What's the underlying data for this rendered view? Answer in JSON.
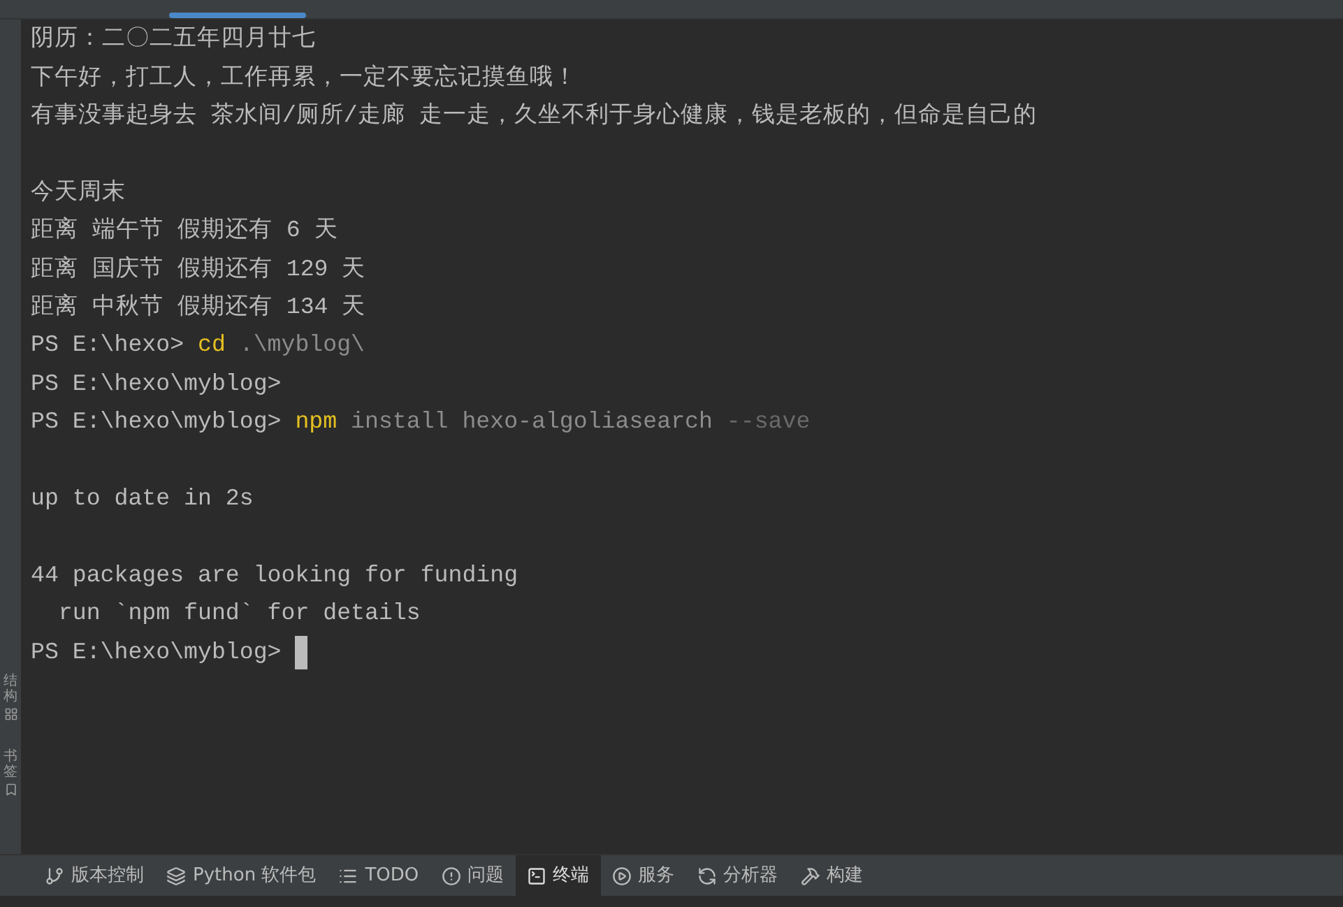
{
  "tabs": [
    {
      "selected": false
    },
    {
      "selected": true
    },
    {
      "selected": false
    }
  ],
  "sidebar": {
    "items": [
      {
        "label": "结构"
      },
      {
        "label": "书签"
      }
    ]
  },
  "terminal": {
    "lines": [
      {
        "segments": [
          {
            "text": "阴历：二〇二五年四月廿七",
            "kind": "text"
          }
        ]
      },
      {
        "segments": [
          {
            "text": "下午好，打工人，工作再累，一定不要忘记摸鱼哦！",
            "kind": "text"
          }
        ]
      },
      {
        "segments": [
          {
            "text": "有事没事起身去 茶水间/厕所/走廊 走一走，久坐不利于身心健康，钱是老板的，但命是自己的",
            "kind": "text"
          }
        ]
      },
      {
        "kind": "blank"
      },
      {
        "segments": [
          {
            "text": "今天周末",
            "kind": "text"
          }
        ]
      },
      {
        "segments": [
          {
            "text": "距离 端午节 假期还有 6 天",
            "kind": "text"
          }
        ]
      },
      {
        "segments": [
          {
            "text": "距离 国庆节 假期还有 129 天",
            "kind": "text"
          }
        ]
      },
      {
        "segments": [
          {
            "text": "距离 中秋节 假期还有 134 天",
            "kind": "text"
          }
        ]
      },
      {
        "segments": [
          {
            "text": "PS E:\\hexo> ",
            "kind": "text"
          },
          {
            "text": "cd",
            "kind": "command"
          },
          {
            "text": " .\\myblog\\",
            "kind": "arg"
          }
        ]
      },
      {
        "segments": [
          {
            "text": "PS E:\\hexo\\myblog>",
            "kind": "text"
          }
        ]
      },
      {
        "segments": [
          {
            "text": "PS E:\\hexo\\myblog> ",
            "kind": "text"
          },
          {
            "text": "npm",
            "kind": "command"
          },
          {
            "text": " install hexo-algoliasearch",
            "kind": "arg"
          },
          {
            "text": " --save",
            "kind": "flag"
          }
        ]
      },
      {
        "kind": "blank"
      },
      {
        "segments": [
          {
            "text": "up to date in 2s",
            "kind": "text"
          }
        ]
      },
      {
        "kind": "blank"
      },
      {
        "segments": [
          {
            "text": "44 packages are looking for funding",
            "kind": "text"
          }
        ]
      },
      {
        "segments": [
          {
            "text": "  run `npm fund` for details",
            "kind": "text"
          }
        ]
      },
      {
        "segments": [
          {
            "text": "PS E:\\hexo\\myblog> ",
            "kind": "text"
          }
        ],
        "cursor": true
      }
    ]
  },
  "toolbar": [
    {
      "label": "版本控制",
      "selected": false
    },
    {
      "label": "Python 软件包",
      "selected": false
    },
    {
      "label": "TODO",
      "selected": false
    },
    {
      "label": "问题",
      "selected": false
    },
    {
      "label": "终端",
      "selected": true
    },
    {
      "label": "服务",
      "selected": false
    },
    {
      "label": "分析器",
      "selected": false
    },
    {
      "label": "构建",
      "selected": false
    }
  ]
}
